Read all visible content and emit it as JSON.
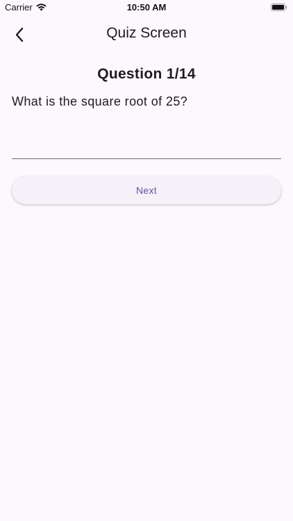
{
  "status_bar": {
    "carrier": "Carrier",
    "time": "10:50 AM",
    "wifi_icon": "wifi-icon",
    "battery_icon": "battery-icon"
  },
  "app_bar": {
    "back_icon": "chevron-left-icon",
    "title": "Quiz Screen"
  },
  "quiz": {
    "question_header": "Question 1/14",
    "question_text": "What is the square root of 25?",
    "answer_value": "",
    "answer_placeholder": "",
    "next_label": "Next"
  },
  "colors": {
    "background": "#fdf8fd",
    "button_text": "#6750a4",
    "button_background": "#f6f1f8",
    "field_underline": "#6f6872"
  }
}
